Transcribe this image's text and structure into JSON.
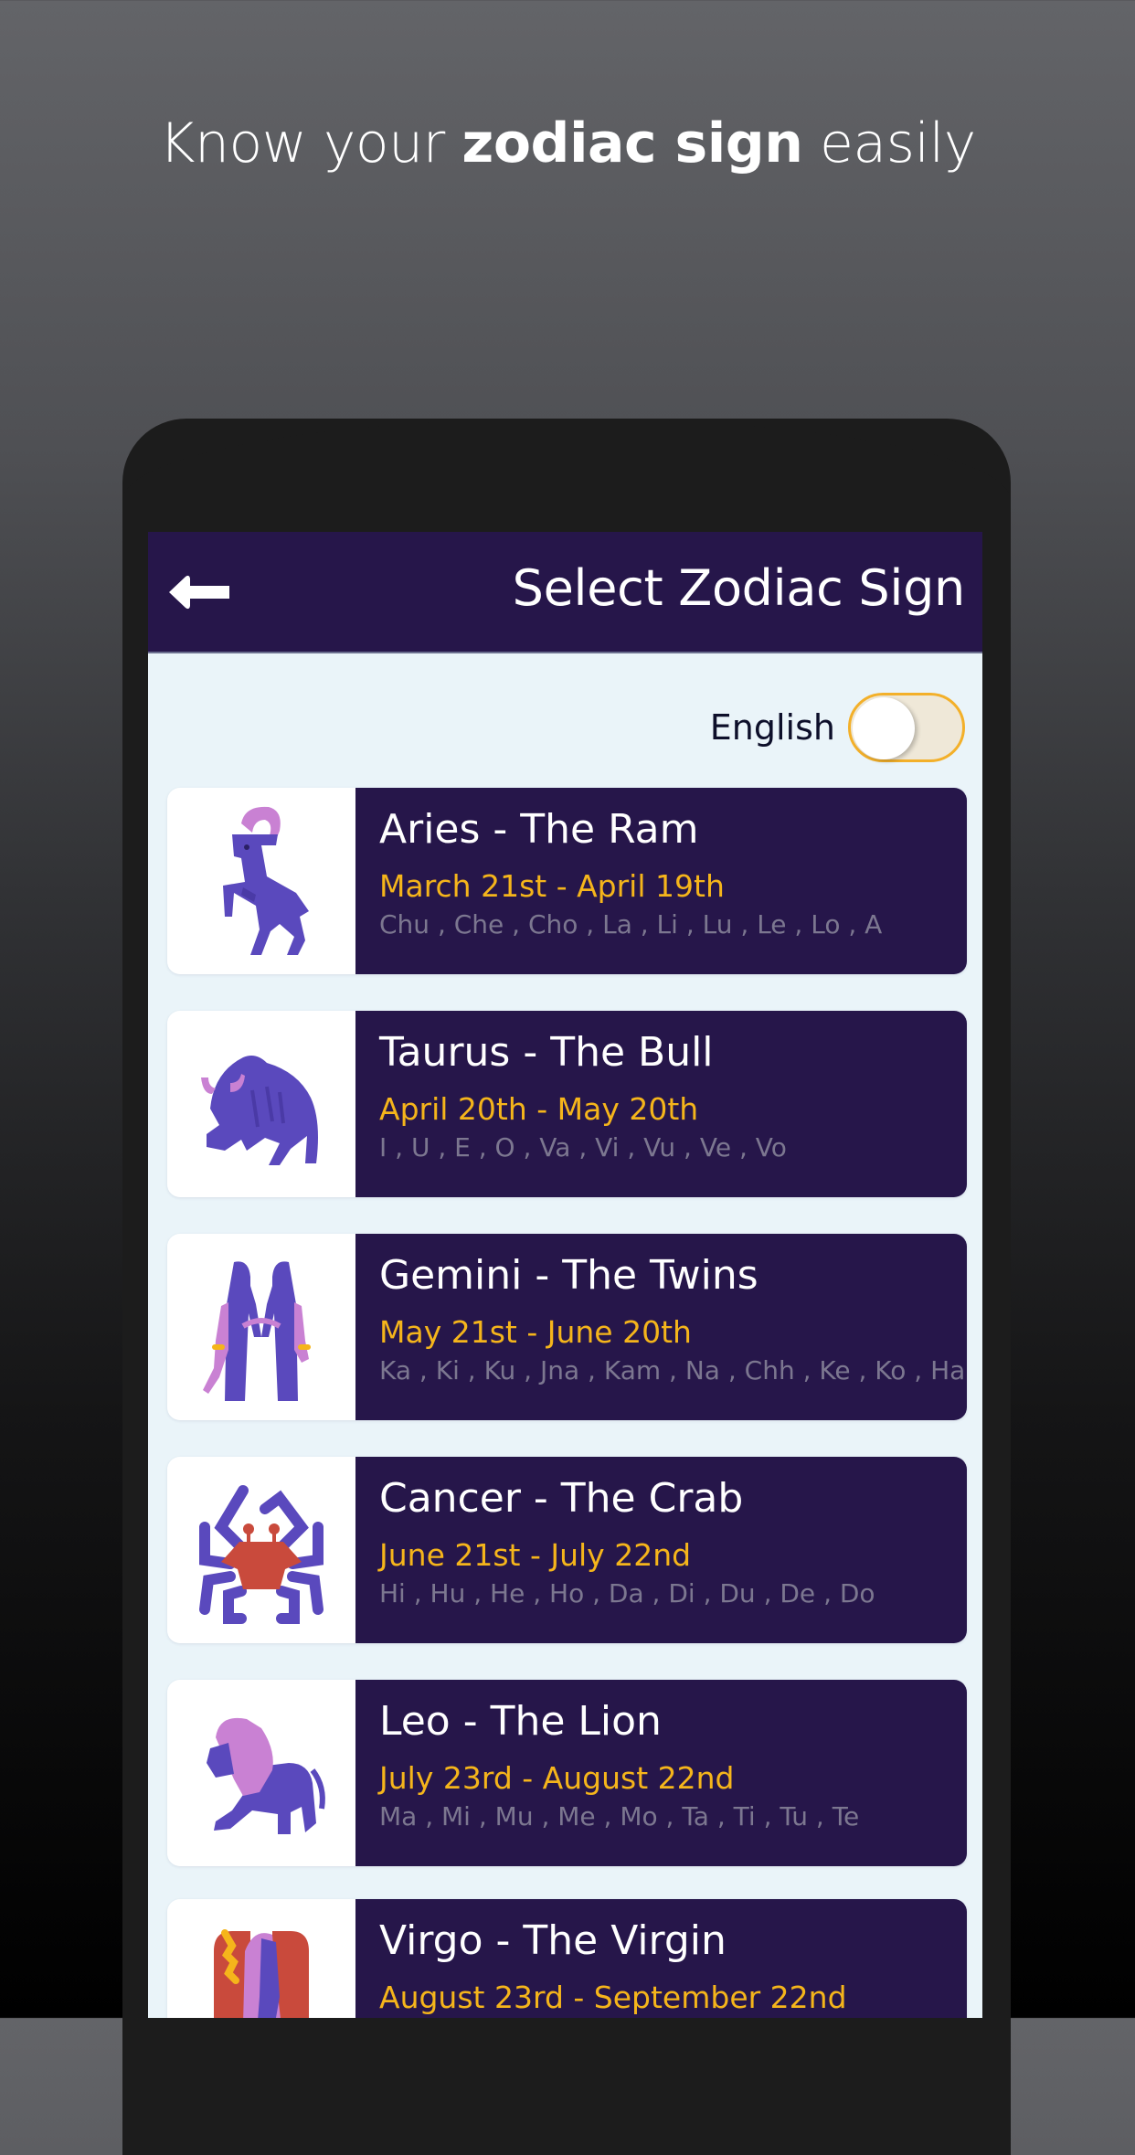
{
  "promo": {
    "headline_pre": "Know your ",
    "headline_bold": "zodiac sign",
    "headline_post": " easily"
  },
  "header": {
    "back_icon": "back-arrow-icon",
    "title": "Select Zodiac Sign"
  },
  "language": {
    "label": "English",
    "toggle_on": false,
    "accent_color": "#f3b02a"
  },
  "colors": {
    "card_bg": "#26164a",
    "date_color": "#f5b51b",
    "syllable_color": "#7c7790",
    "screen_bg": "#eaf4f9"
  },
  "signs": [
    {
      "title": "Aries - The Ram",
      "dates": "March 21st - April 19th",
      "syllables": "Chu , Che , Cho , La , Li , Lu , Le , Lo , A",
      "icon": "ram-icon"
    },
    {
      "title": "Taurus - The Bull",
      "dates": "April 20th - May 20th",
      "syllables": "I , U , E , O , Va , Vi , Vu , Ve , Vo",
      "icon": "bull-icon"
    },
    {
      "title": "Gemini - The Twins",
      "dates": "May 21st - June 20th",
      "syllables": "Ka , Ki , Ku , Jna , Kam , Na , Chh , Ke , Ko , Ha",
      "icon": "twins-icon"
    },
    {
      "title": "Cancer - The Crab",
      "dates": "June 21st - July 22nd",
      "syllables": "Hi , Hu , He , Ho , Da , Di , Du , De , Do",
      "icon": "crab-icon"
    },
    {
      "title": "Leo - The Lion",
      "dates": "July 23rd - August 22nd",
      "syllables": "Ma , Mi , Mu , Me , Mo , Ta , Ti , Tu , Te",
      "icon": "lion-icon"
    },
    {
      "title": "Virgo - The Virgin",
      "dates": "August 23rd - September 22nd",
      "syllables": "",
      "icon": "virgin-icon"
    }
  ]
}
